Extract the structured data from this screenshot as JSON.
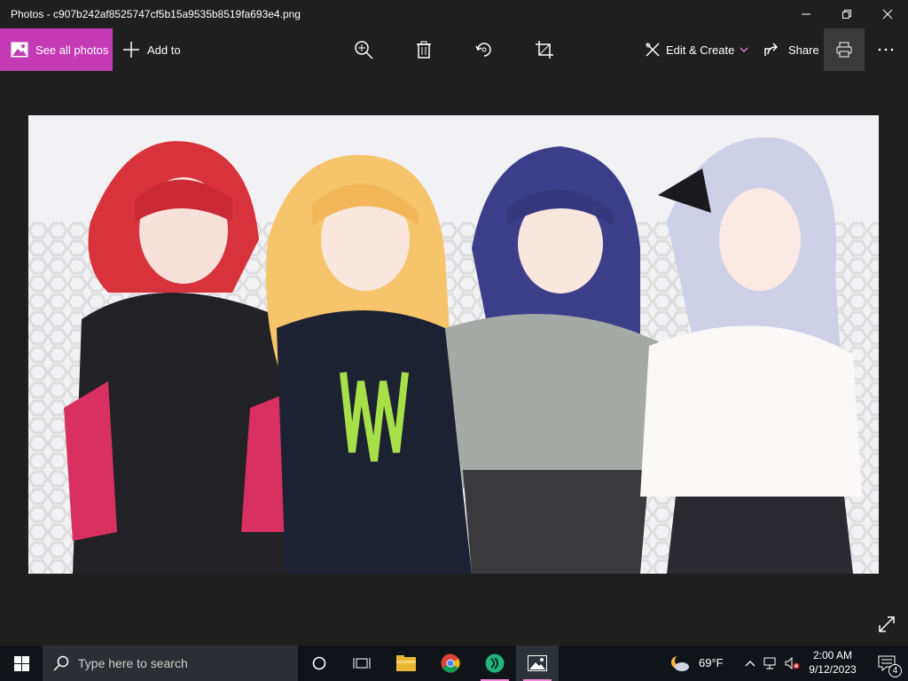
{
  "window": {
    "title": "Photos - c907b242af8525747cf5b15a9535b8519fa693e4.png"
  },
  "toolbar": {
    "see_all_label": "See all photos",
    "add_to_label": "Add to",
    "edit_create_label": "Edit & Create",
    "share_label": "Share"
  },
  "taskbar": {
    "search_placeholder": "Type here to search",
    "weather_temp": "69°F",
    "time": "2:00 AM",
    "date": "9/12/2023",
    "notification_count": "4"
  },
  "colors": {
    "accent": "#c43ab5",
    "background": "#1f1f1f",
    "taskbar": "#101418"
  },
  "icons": [
    "minimize-icon",
    "maximize-icon",
    "close-icon",
    "photos-icon",
    "plus-icon",
    "zoom-in-icon",
    "delete-icon",
    "rotate-icon",
    "crop-icon",
    "edit-icon",
    "chevron-down-icon",
    "share-icon",
    "print-icon",
    "more-icon",
    "expand-icon",
    "windows-icon",
    "search-icon",
    "cortana-icon",
    "task-view-icon",
    "file-explorer-icon",
    "chrome-icon",
    "app-icon",
    "weather-icon",
    "chevron-up-icon",
    "network-icon",
    "volume-icon",
    "notifications-icon"
  ]
}
